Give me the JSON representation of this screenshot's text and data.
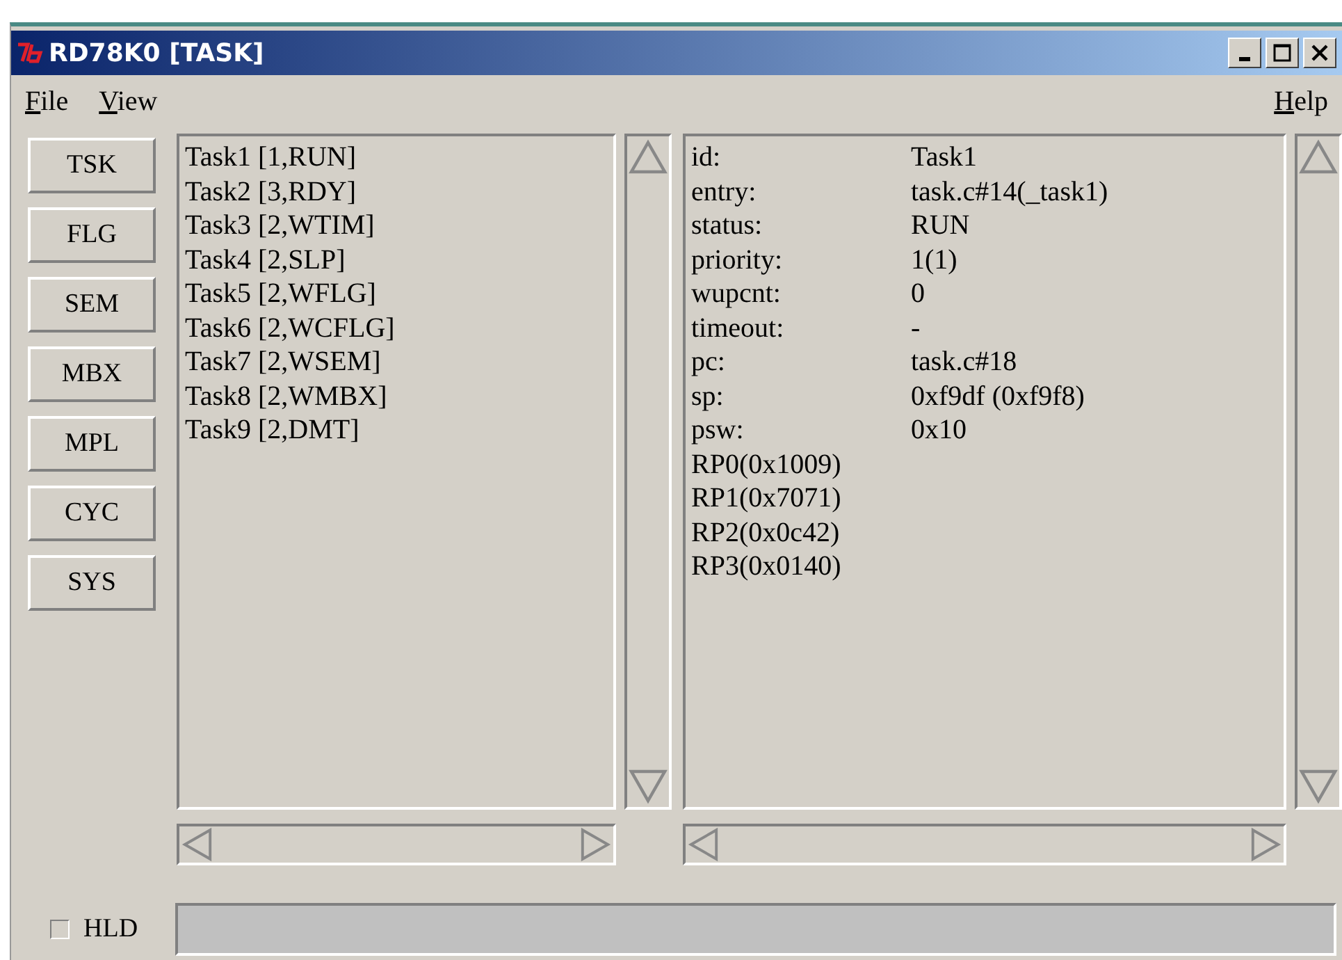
{
  "window": {
    "title": "RD78K0 [TASK]"
  },
  "menu": [
    "File",
    "View",
    "Help"
  ],
  "side_buttons": [
    "TSK",
    "FLG",
    "SEM",
    "MBX",
    "MPL",
    "CYC",
    "SYS"
  ],
  "task_list": [
    "Task1 [1,RUN]",
    "Task2 [3,RDY]",
    "Task3 [2,WTIM]",
    "Task4 [2,SLP]",
    "Task5 [2,WFLG]",
    "Task6 [2,WCFLG]",
    "Task7 [2,WSEM]",
    "Task8 [2,WMBX]",
    "Task9 [2,DMT]"
  ],
  "details": [
    {
      "label": "id:",
      "value": "Task1"
    },
    {
      "label": "entry:",
      "value": "task.c#14(_task1)"
    },
    {
      "label": "status:",
      "value": "RUN"
    },
    {
      "label": "priority:",
      "value": "1(1)"
    },
    {
      "label": "wupcnt:",
      "value": "0"
    },
    {
      "label": "timeout:",
      "value": "-"
    },
    {
      "label": "pc:",
      "value": "task.c#18"
    },
    {
      "label": "sp:",
      "value": "0xf9df (0xf9f8)"
    },
    {
      "label": "psw:",
      "value": "0x10"
    }
  ],
  "registers": [
    "RP0(0x1009)",
    "RP1(0x7071)",
    "RP2(0x0c42)",
    "RP3(0x0140)"
  ],
  "hold": {
    "label": "HLD",
    "checked": false
  }
}
